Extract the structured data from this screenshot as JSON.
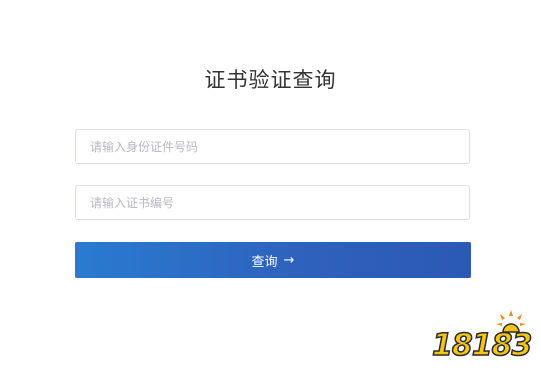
{
  "page": {
    "title": "证书验证查询"
  },
  "form": {
    "id_field": {
      "placeholder": "请输入身份证件号码",
      "value": ""
    },
    "cert_field": {
      "placeholder": "请输入证书编号",
      "value": ""
    },
    "query_button": {
      "label": "查询",
      "icon": "arrow-right-icon",
      "arrow": "→"
    }
  },
  "watermark": {
    "text": "18183"
  },
  "colors": {
    "button_start": "#2a7bd0",
    "button_end": "#2b59b5",
    "input_border": "#dcdfe6",
    "logo_yellow": "#f5c518"
  }
}
